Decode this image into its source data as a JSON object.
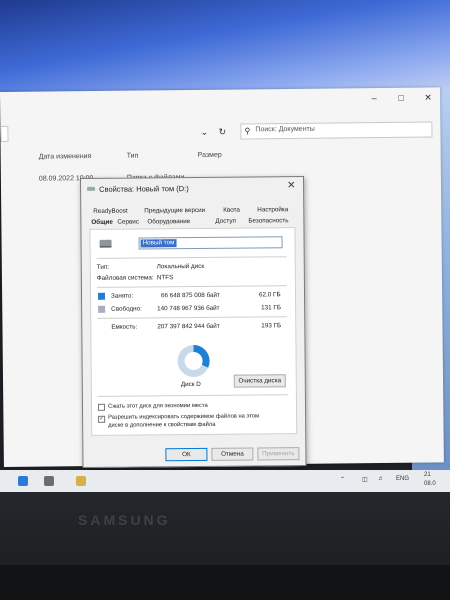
{
  "explorer": {
    "search_placeholder": "Поиск: Документы",
    "columns": {
      "date": "Дата изменения",
      "type": "Тип",
      "size": "Размер"
    },
    "row": {
      "date": "08.09.2022 10:00",
      "type": "Папка с файлами"
    }
  },
  "dialog": {
    "title": "Свойства: Новый том (D:)",
    "tabs_row1": [
      "ReadyBoost",
      "Предыдущие версии",
      "Квота",
      "Настройка"
    ],
    "tabs_row2": [
      "Общие",
      "Сервис",
      "Оборудование",
      "Доступ",
      "Безопасность"
    ],
    "active_tab": "Общие",
    "volume_name": "Новый том",
    "type_label": "Тип:",
    "type_value": "Локальный диск",
    "fs_label": "Файловая система:",
    "fs_value": "NTFS",
    "used": {
      "label": "Занято:",
      "bytes": "66 648 875 008 байт",
      "size": "62,0 ГБ",
      "color": "#1f7fd1"
    },
    "free": {
      "label": "Свободно:",
      "bytes": "140 748 967 936 байт",
      "size": "131 ГБ",
      "color": "#a6afbb"
    },
    "capacity": {
      "label": "Емкость:",
      "bytes": "207 397 842 944 байт",
      "size": "193 ГБ"
    },
    "used_fraction": 0.32,
    "disk_label": "Диск D",
    "cleanup_button": "Очистка диска",
    "compress_option": "Сжать этот диск для экономии места",
    "index_option_line1": "Разрешить индексировать содержимое файлов на этом",
    "index_option_line2": "диске в дополнение к свойствам файла",
    "ok_button": "ОК",
    "cancel_button": "Отмена",
    "apply_button": "Применить"
  },
  "taskbar": {
    "lang": "ENG",
    "time": "21",
    "date": "08.0"
  },
  "laptop": {
    "brand": "SAMSUNG"
  },
  "colors": {
    "accent": "#0078d7",
    "wallpaper": "#3e6ad6"
  }
}
